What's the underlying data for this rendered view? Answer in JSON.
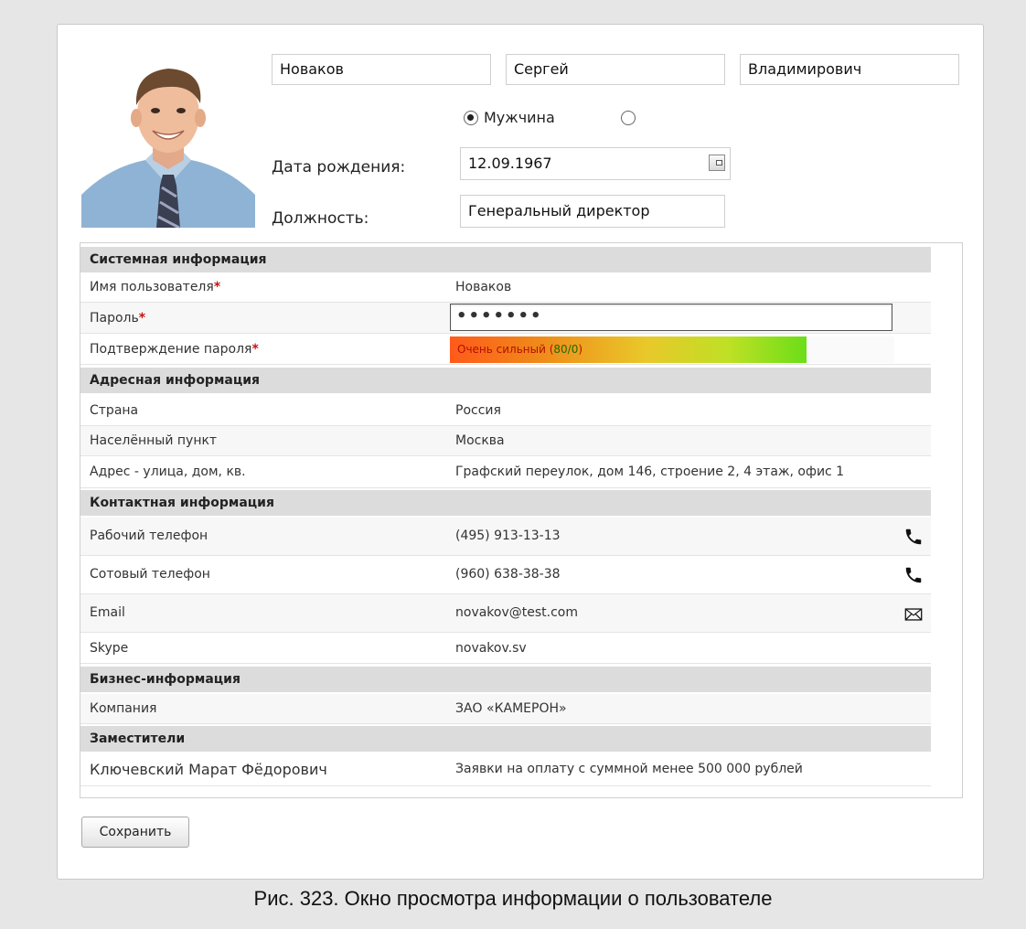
{
  "user": {
    "last_name": "Новаков",
    "first_name": "Сергей",
    "middle_name": "Владимирович",
    "gender_male_label": "Мужчина",
    "gender_selected": "male",
    "birthdate_label": "Дата рождения:",
    "birthdate": "12.09.1967",
    "position_label": "Должность:",
    "position": "Генеральный директор"
  },
  "sections": {
    "system": {
      "title": "Системная информация",
      "username_label": "Имя пользователя",
      "username": "Новаков",
      "password_label": "Пароль",
      "password_mask": "•••••••",
      "confirm_label": "Подтверждение пароля",
      "strength_text": "Очень сильный (",
      "strength_score": "80/0",
      "strength_close": ")",
      "required_mark": "*"
    },
    "address": {
      "title": "Адресная информация",
      "country_label": "Страна",
      "country": "Россия",
      "city_label": "Населённый пункт",
      "city": "Москва",
      "street_label": "Адрес - улица, дом, кв.",
      "street": "Графский переулок, дом 146, строение 2, 4 этаж, офис 1"
    },
    "contact": {
      "title": "Контактная информация",
      "work_phone_label": "Рабочий телефон",
      "work_phone": "(495) 913-13-13",
      "mobile_label": "Сотовый телефон",
      "mobile": "(960) 638-38-38",
      "email_label": "Email",
      "email": "novakov@test.com",
      "skype_label": "Skype",
      "skype": "novakov.sv"
    },
    "business": {
      "title": "Бизнес-информация",
      "company_label": "Компания",
      "company": "ЗАО «КАМЕРОН»"
    },
    "deputies": {
      "title": "Заместители",
      "deputy_name": "Ключевский Марат Фёдорович",
      "deputy_scope": "Заявки на оплату с суммной менее 500 000 рублей"
    }
  },
  "buttons": {
    "save": "Сохранить"
  },
  "caption": "Рис. 323. Окно просмотра информации о пользователе",
  "colors": {
    "section_bg": "#dcdcdc",
    "required": "#cc1111",
    "strength_start": "#ff5a1a",
    "strength_end": "#6cde18"
  },
  "icons": {
    "avatar": "user-photo",
    "calendar": "calendar-icon",
    "phone": "phone-icon",
    "email": "envelope-icon"
  }
}
